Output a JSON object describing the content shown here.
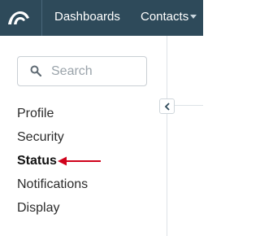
{
  "topnav": {
    "logo_icon": "app-logo-icon",
    "dashboards_label": "Dashboards",
    "contacts_label": "Contacts",
    "contacts_icon": "chevron-down-icon",
    "background_color": "#2e4a5a"
  },
  "sidebar": {
    "search": {
      "placeholder": "Search",
      "icon": "search-icon"
    },
    "items": [
      {
        "label": "Profile"
      },
      {
        "label": "Security"
      },
      {
        "label": "Status",
        "active": true
      },
      {
        "label": "Notifications"
      },
      {
        "label": "Display"
      }
    ],
    "collapse_icon": "chevron-left-icon"
  },
  "annotation": {
    "icon": "red-arrow-icon",
    "color": "#d0021b"
  }
}
